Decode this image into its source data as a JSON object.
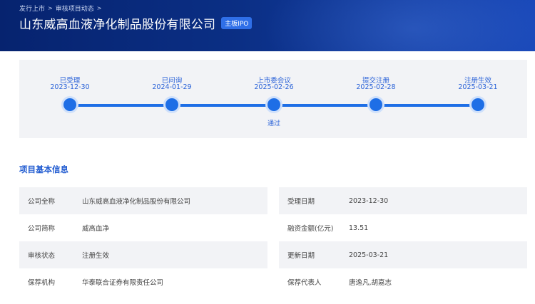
{
  "breadcrumb": {
    "item1": "发行上市",
    "separator": ">",
    "item2": "审核项目动态",
    "separator2": ">"
  },
  "header": {
    "title": "山东威高血液净化制品股份有限公司",
    "badge": "主板IPO"
  },
  "timeline": {
    "steps": [
      {
        "label": "已受理",
        "date": "2023-12-30",
        "status": ""
      },
      {
        "label": "已问询",
        "date": "2024-01-29",
        "status": ""
      },
      {
        "label": "上市委会议",
        "date": "2025-02-26",
        "status": "通过"
      },
      {
        "label": "提交注册",
        "date": "2025-02-28",
        "status": ""
      },
      {
        "label": "注册生效",
        "date": "2025-03-21",
        "status": ""
      }
    ]
  },
  "section_title": "项目基本信息",
  "info": {
    "rows": [
      {
        "left_label": "公司全称",
        "left_value": "山东威高血液净化制品股份有限公司",
        "right_label": "受理日期",
        "right_value": "2023-12-30"
      },
      {
        "left_label": "公司简称",
        "left_value": "威高血净",
        "right_label": "融资金额(亿元)",
        "right_value": "13.51"
      },
      {
        "left_label": "审核状态",
        "left_value": "注册生效",
        "right_label": "更新日期",
        "right_value": "2025-03-21"
      },
      {
        "left_label": "保荐机构",
        "left_value": "华泰联合证券有限责任公司",
        "right_label": "保荐代表人",
        "right_value": "唐逸凡,胡嘉志"
      }
    ]
  },
  "colors": {
    "header_dark": "#06236f",
    "accent": "#1e6ee6",
    "panel_bg": "#f2f3f6"
  }
}
